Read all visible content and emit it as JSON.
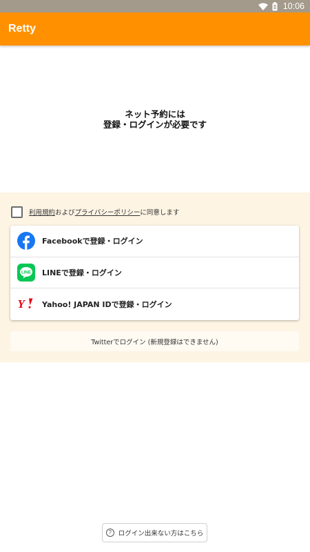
{
  "status_bar": {
    "time": "10:06",
    "icons": [
      "wifi-icon",
      "battery-icon"
    ]
  },
  "app_bar": {
    "title": "Retty"
  },
  "intro": {
    "line1": "ネット予約には",
    "line2": "登録・ログインが必要です"
  },
  "agreement": {
    "terms_link": "利用規約",
    "and_text": "および",
    "privacy_link": "プライバシーポリシー",
    "suffix": "に同意します",
    "checked": false
  },
  "providers": [
    {
      "label": "Facebookで登録・ログイン",
      "icon": "facebook-icon",
      "color": "#1877f2"
    },
    {
      "label": "LINEで登録・ログイン",
      "icon": "line-icon",
      "color": "#06c755"
    },
    {
      "label": "Yahoo! JAPAN IDで登録・ログイン",
      "icon": "yahoo-japan-icon",
      "color": "#e60012"
    }
  ],
  "twitter": {
    "label": "Twitterでログイン (新規登録はできません)"
  },
  "help": {
    "label": "ログイン出来ない方はこちら",
    "icon": "question-icon"
  },
  "colors": {
    "accent": "#ff9100",
    "panel": "#fdf4e4",
    "status_bar": "#a39a8b"
  }
}
